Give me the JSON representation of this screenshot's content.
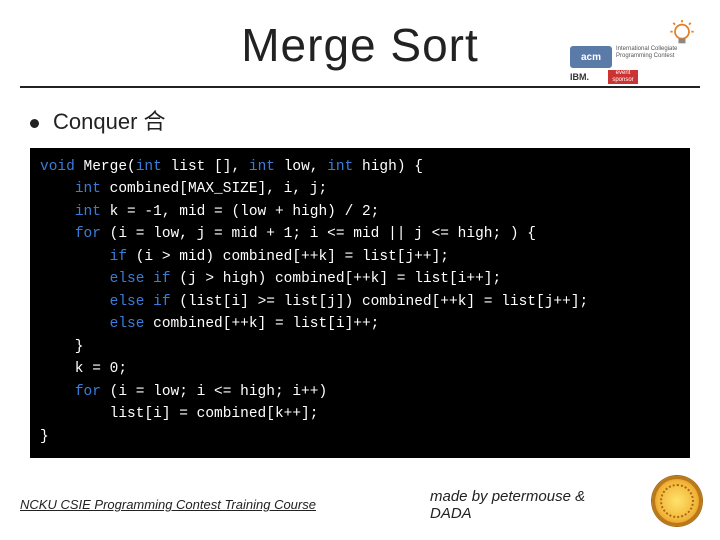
{
  "title": "Merge Sort",
  "bullet": {
    "label": "Conquer 合"
  },
  "code": {
    "lines": [
      {
        "segments": [
          {
            "t": "void ",
            "c": "kw"
          },
          {
            "t": "Merge(",
            "c": "ws"
          },
          {
            "t": "int ",
            "c": "kw"
          },
          {
            "t": "list [], ",
            "c": "ws"
          },
          {
            "t": "int ",
            "c": "kw"
          },
          {
            "t": "low, ",
            "c": "ws"
          },
          {
            "t": "int ",
            "c": "kw"
          },
          {
            "t": "high) {",
            "c": "ws"
          }
        ]
      },
      {
        "segments": [
          {
            "t": "    ",
            "c": "ws"
          },
          {
            "t": "int ",
            "c": "kw"
          },
          {
            "t": "combined[MAX_SIZE], i, j;",
            "c": "ws"
          }
        ]
      },
      {
        "segments": [
          {
            "t": "    ",
            "c": "ws"
          },
          {
            "t": "int ",
            "c": "kw"
          },
          {
            "t": "k = -1, mid = (low + high) / 2;",
            "c": "ws"
          }
        ]
      },
      {
        "segments": [
          {
            "t": "    ",
            "c": "ws"
          },
          {
            "t": "for ",
            "c": "kw"
          },
          {
            "t": "(i = low, j = mid + 1; i <= mid || j <= high; ) {",
            "c": "ws"
          }
        ]
      },
      {
        "segments": [
          {
            "t": "        ",
            "c": "ws"
          },
          {
            "t": "if ",
            "c": "kw"
          },
          {
            "t": "(i > mid) combined[++k] = list[j++];",
            "c": "ws"
          }
        ]
      },
      {
        "segments": [
          {
            "t": "        ",
            "c": "ws"
          },
          {
            "t": "else if ",
            "c": "kw"
          },
          {
            "t": "(j > high) combined[++k] = list[i++];",
            "c": "ws"
          }
        ]
      },
      {
        "segments": [
          {
            "t": "        ",
            "c": "ws"
          },
          {
            "t": "else if ",
            "c": "kw"
          },
          {
            "t": "(list[i] >= list[j]) combined[++k] = list[j++];",
            "c": "ws"
          }
        ]
      },
      {
        "segments": [
          {
            "t": "        ",
            "c": "ws"
          },
          {
            "t": "else ",
            "c": "kw"
          },
          {
            "t": "combined[++k] = list[i]++;",
            "c": "ws"
          }
        ]
      },
      {
        "segments": [
          {
            "t": "    }",
            "c": "ws"
          }
        ]
      },
      {
        "segments": [
          {
            "t": "    k = 0;",
            "c": "ws"
          }
        ]
      },
      {
        "segments": [
          {
            "t": "    ",
            "c": "ws"
          },
          {
            "t": "for ",
            "c": "kw"
          },
          {
            "t": "(i = low; i <= high; i++)",
            "c": "ws"
          }
        ]
      },
      {
        "segments": [
          {
            "t": "        list[i] = combined[k++];",
            "c": "ws"
          }
        ]
      },
      {
        "segments": [
          {
            "t": "}",
            "c": "ws"
          }
        ]
      }
    ]
  },
  "logos": {
    "acm": "acm",
    "icpc": "International Collegiate Programming Contest",
    "ibm": "IBM.",
    "sponsor": "event sponsor"
  },
  "footer": {
    "left": "NCKU CSIE Programming Contest Training Course",
    "right": "made by petermouse & DADA"
  }
}
